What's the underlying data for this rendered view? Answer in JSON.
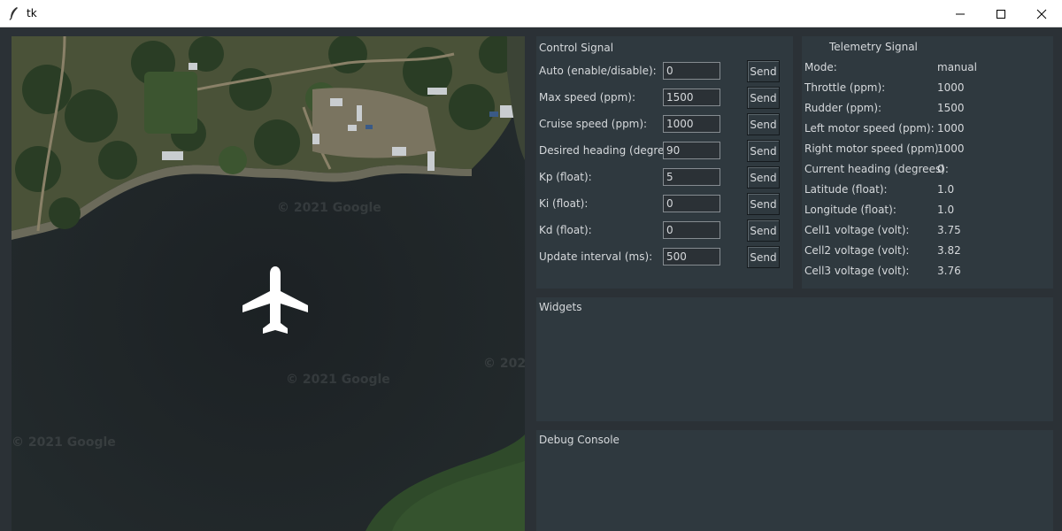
{
  "window": {
    "title": "tk"
  },
  "map": {
    "watermarks": [
      "© 2021 Google",
      "© 2021 Google",
      "© 2021 Google",
      "© 202"
    ],
    "marker_icon": "airplane-icon"
  },
  "control": {
    "title": "Control Signal",
    "send_label": "Send",
    "rows": [
      {
        "label": "Auto (enable/disable):",
        "value": "0"
      },
      {
        "label": "Max speed (ppm):",
        "value": "1500"
      },
      {
        "label": "Cruise speed (ppm):",
        "value": "1000"
      },
      {
        "label": "Desired heading (degree):",
        "value": "90"
      },
      {
        "label": "Kp (float):",
        "value": "5"
      },
      {
        "label": "Ki (float):",
        "value": "0"
      },
      {
        "label": "Kd (float):",
        "value": "0"
      },
      {
        "label": "Update interval (ms):",
        "value": "500"
      }
    ]
  },
  "telemetry": {
    "title": "Telemetry Signal",
    "rows": [
      {
        "label": "Mode:",
        "value": "manual"
      },
      {
        "label": "Throttle (ppm):",
        "value": "1000"
      },
      {
        "label": "Rudder (ppm):",
        "value": "1500"
      },
      {
        "label": "Left motor speed (ppm):",
        "value": "1000"
      },
      {
        "label": "Right motor speed (ppm):",
        "value": "1000"
      },
      {
        "label": "Current heading (degrees):",
        "value": "0"
      },
      {
        "label": "Latitude (float):",
        "value": "1.0"
      },
      {
        "label": "Longitude (float):",
        "value": "1.0"
      },
      {
        "label": "Cell1 voltage (volt):",
        "value": "3.75"
      },
      {
        "label": "Cell2 voltage (volt):",
        "value": "3.82"
      },
      {
        "label": "Cell3 voltage (volt):",
        "value": "3.76"
      }
    ]
  },
  "widgets": {
    "title": "Widgets"
  },
  "debug": {
    "title": "Debug Console"
  }
}
